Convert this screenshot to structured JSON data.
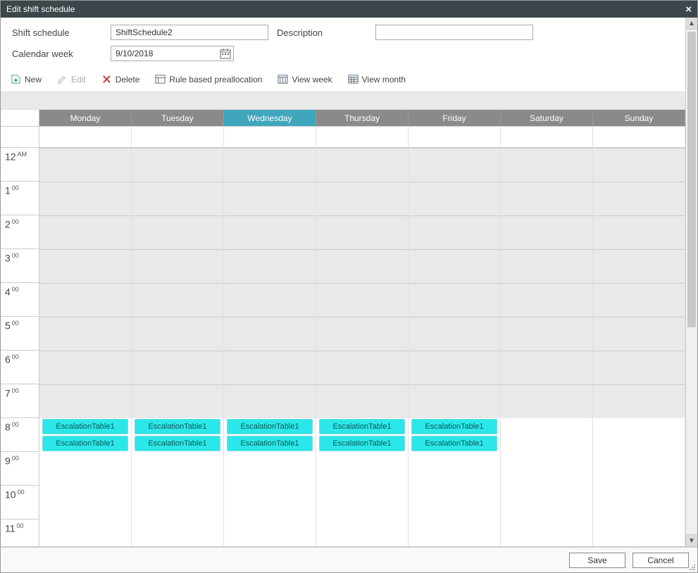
{
  "window": {
    "title": "Edit shift schedule",
    "close_label": "×"
  },
  "form": {
    "shift_label": "Shift schedule",
    "shift_value": "ShiftSchedule2",
    "desc_label": "Description",
    "desc_value": "",
    "week_label": "Calendar week",
    "week_value": "9/10/2018"
  },
  "toolbar": {
    "new": "New",
    "edit": "Edit",
    "delete": "Delete",
    "rule": "Rule based preallocation",
    "view_week": "View week",
    "view_month": "View month"
  },
  "calendar": {
    "days": [
      "Monday",
      "Tuesday",
      "Wednesday",
      "Thursday",
      "Friday",
      "Saturday",
      "Sunday"
    ],
    "active_day_index": 2,
    "hours": [
      {
        "h": "12",
        "sup": "AM"
      },
      {
        "h": "1",
        "sup": "00"
      },
      {
        "h": "2",
        "sup": "00"
      },
      {
        "h": "3",
        "sup": "00"
      },
      {
        "h": "4",
        "sup": "00"
      },
      {
        "h": "5",
        "sup": "00"
      },
      {
        "h": "6",
        "sup": "00"
      },
      {
        "h": "7",
        "sup": "00"
      },
      {
        "h": "8",
        "sup": "00"
      },
      {
        "h": "9",
        "sup": "00"
      },
      {
        "h": "10",
        "sup": "00"
      },
      {
        "h": "11",
        "sup": "00"
      }
    ],
    "event_label": "EscalationTable1",
    "events": [
      {
        "day": 0,
        "hour": 8,
        "slot": 0
      },
      {
        "day": 0,
        "hour": 8,
        "slot": 1
      },
      {
        "day": 1,
        "hour": 8,
        "slot": 0
      },
      {
        "day": 1,
        "hour": 8,
        "slot": 1
      },
      {
        "day": 2,
        "hour": 8,
        "slot": 0
      },
      {
        "day": 2,
        "hour": 8,
        "slot": 1
      },
      {
        "day": 3,
        "hour": 8,
        "slot": 0
      },
      {
        "day": 3,
        "hour": 8,
        "slot": 1
      },
      {
        "day": 4,
        "hour": 8,
        "slot": 0
      },
      {
        "day": 4,
        "hour": 8,
        "slot": 1
      }
    ],
    "free_hours": [
      8,
      9,
      10,
      11
    ]
  },
  "footer": {
    "save": "Save",
    "cancel": "Cancel"
  }
}
